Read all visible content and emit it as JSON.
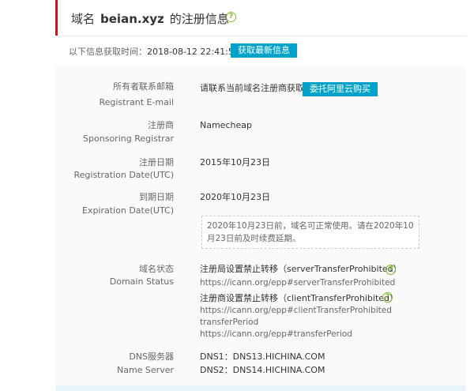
{
  "header": {
    "prefix": "域名",
    "domain": "beian.xyz",
    "suffix": "的注册信息",
    "help_icon": "question-circle-icon"
  },
  "fetch": {
    "label": "以下信息获取时间：",
    "time": "2018-08-12 22:41:57",
    "button": "获取最新信息"
  },
  "fields": {
    "email": {
      "label_cn": "所有者联系邮箱",
      "label_en": "Registrant E-mail",
      "value": "请联系当前域名注册商获取",
      "button": "委托阿里云购买"
    },
    "registrar": {
      "label_cn": "注册商",
      "label_en": "Sponsoring Registrar",
      "value": "Namecheap"
    },
    "reg_date": {
      "label_cn": "注册日期",
      "label_en": "Registration Date(UTC)",
      "value": "2015年10月23日"
    },
    "exp_date": {
      "label_cn": "到期日期",
      "label_en": "Expiration Date(UTC)",
      "value": "2020年10月23日",
      "notice": "2020年10月23日前，域名可正常使用。请在2020年10月23日前及时续费延期。"
    },
    "status": {
      "label_cn": "域名状态",
      "label_en": "Domain Status",
      "items": [
        {
          "text": "注册局设置禁止转移（serverTransferProhibited）",
          "link": "https://icann.org/epp#serverTransferProhibited"
        },
        {
          "text": "注册商设置禁止转移（clientTransferProhibited）",
          "link": "https://icann.org/epp#clientTransferProhibited"
        }
      ],
      "extra_text": "transferPeriod",
      "extra_link": "https://icann.org/epp#transferPeriod"
    },
    "dns": {
      "label_cn": "DNS服务器",
      "label_en": "Name Server",
      "values": [
        "DNS1：DNS13.HICHINA.COM",
        "DNS2：DNS14.HICHINA.COM"
      ]
    }
  }
}
